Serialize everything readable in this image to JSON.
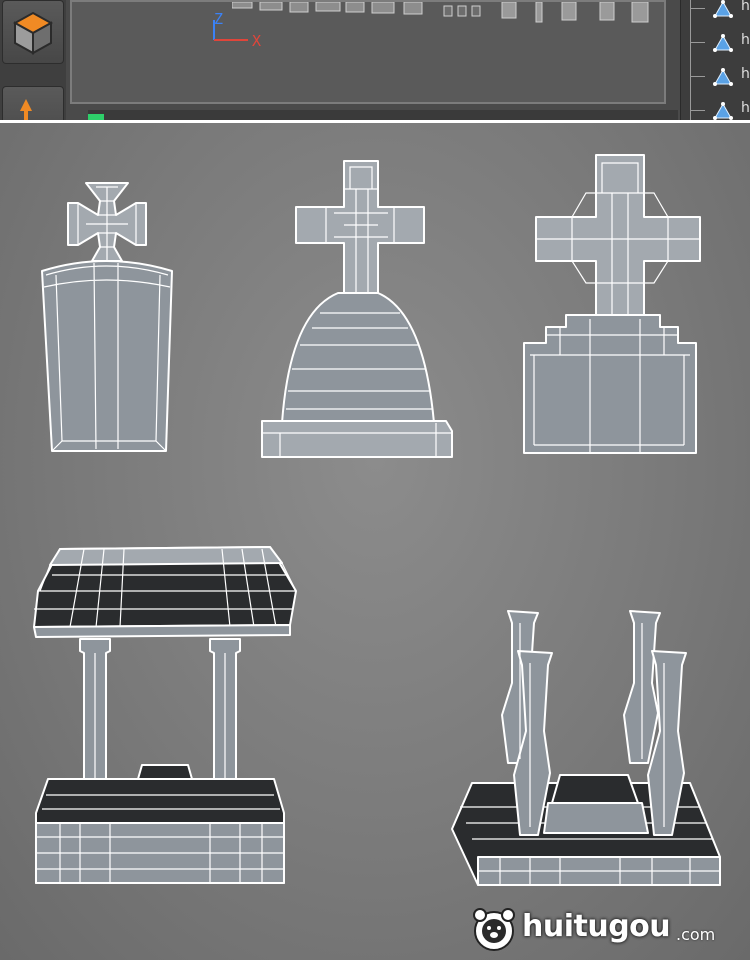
{
  "editor": {
    "axis_z": "Z",
    "axis_x": "X",
    "outliner_label": "h",
    "icons": {
      "tool_primary": "cube-icon",
      "tool_secondary": "move-arrow-icon",
      "outliner_object": "triangle-vertices-icon"
    },
    "colors": {
      "axis_z": "#3b82f6",
      "axis_x": "#e0453a",
      "cube_orange": "#f08a24",
      "timeline_marker": "#2ecf6a"
    }
  },
  "viewport": {
    "models": [
      "bottle-tombstone",
      "cross-headstone",
      "block-cross-headstone",
      "canopy-tomb",
      "pillar-tomb"
    ]
  },
  "watermark": {
    "text": "huitugou",
    "tld": ".com"
  }
}
